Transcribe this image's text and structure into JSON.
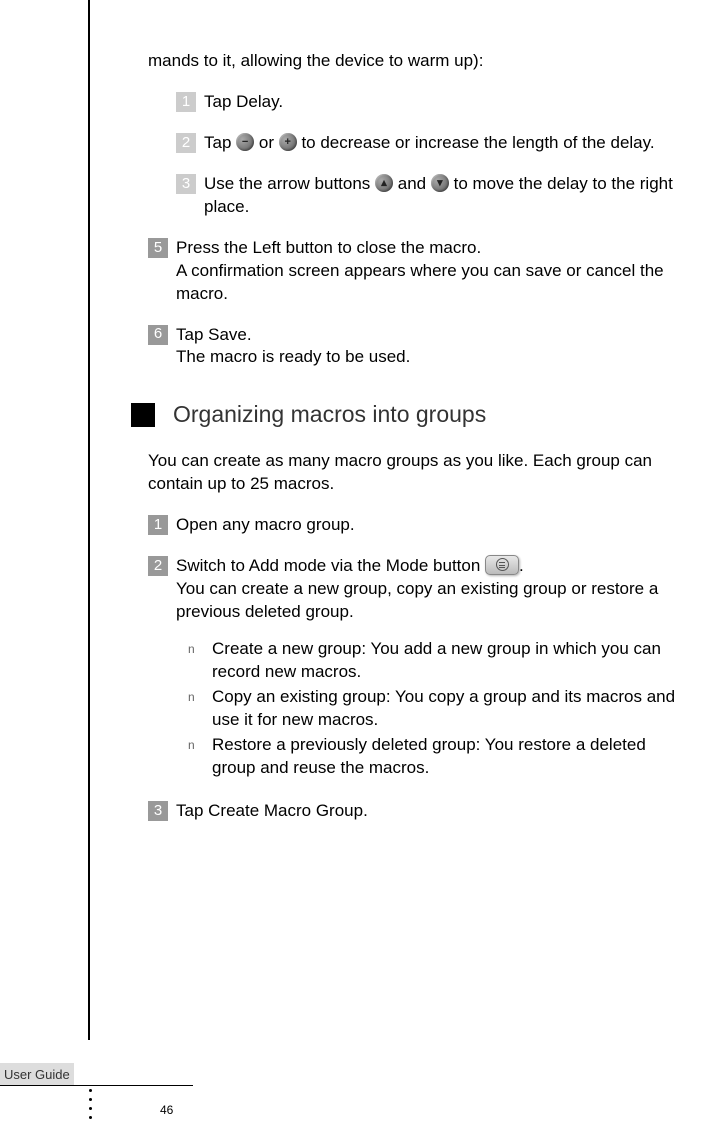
{
  "intro": "mands to it, allowing the device to warm up):",
  "sub1_num": "1",
  "sub1_text": "Tap Delay.",
  "sub2_num": "2",
  "sub2_a": "Tap ",
  "sub2_b": " or ",
  "sub2_c": " to decrease or increase the length of the delay.",
  "sub3_num": "3",
  "sub3_a": "Use the arrow buttons ",
  "sub3_b": " and ",
  "sub3_c": " to move the delay to the right place.",
  "step5_num": "5",
  "step5_text": "Press the Left button to close the macro.\nA confirmation screen appears where you can save or cancel the macro.",
  "step6_num": "6",
  "step6_text": "Tap Save.\nThe macro is ready to be used.",
  "section_title": "Organizing macros into groups",
  "section_para": "You can create as many macro groups as you like. Each group can contain up to 25 macros.",
  "g1_num": "1",
  "g1_text": "Open any macro group.",
  "g2_num": "2",
  "g2_a": "Switch to Add mode via the Mode button ",
  "g2_b": ".\nYou can create a new group, copy an existing group or restore a previous deleted group.",
  "bullets": {
    "b1": "Create a new group: You add a new group in which you can record new macros.",
    "b2": "Copy an existing group: You copy a group and its macros and use it for new macros.",
    "b3": "Restore a previously deleted group: You restore a deleted group and reuse the macros."
  },
  "g3_num": "3",
  "g3_text": "Tap Create Macro Group.",
  "footer_label": "User Guide",
  "page_number": "46",
  "bullet_marker": "n"
}
